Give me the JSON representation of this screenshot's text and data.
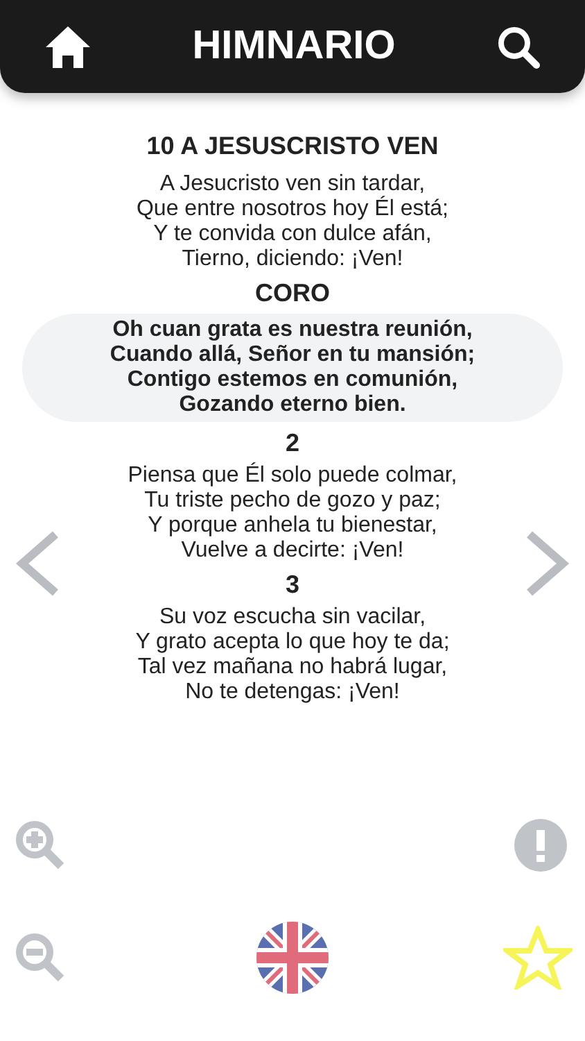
{
  "header": {
    "title": "HIMNARIO"
  },
  "hymn": {
    "title": "10 A JESUSCRISTO VEN",
    "sections": [
      {
        "kind": "verse",
        "lines": [
          "A Jesucristo ven sin tardar,",
          "Que entre nosotros hoy Él está;",
          "Y te convida con dulce afán,",
          "Tierno, diciendo: ¡Ven!"
        ]
      },
      {
        "kind": "chorus",
        "heading": "CORO",
        "lines": [
          "Oh cuan grata es nuestra reunión,",
          "Cuando allá, Señor en tu mansión;",
          "Contigo estemos en comunión,",
          "Gozando eterno bien."
        ]
      },
      {
        "kind": "verse",
        "heading": "2",
        "lines": [
          "Piensa que Él solo puede colmar,",
          "Tu triste pecho de gozo y paz;",
          "Y porque anhela tu bienestar,",
          "Vuelve a decirte: ¡Ven!"
        ]
      },
      {
        "kind": "verse",
        "heading": "3",
        "lines": [
          "Su voz escucha sin vacilar,",
          "Y grato acepta lo que hoy te da;",
          "Tal vez mañana no habrá lugar,",
          "No te detengas: ¡Ven!"
        ]
      }
    ]
  },
  "favorite": {
    "on": false
  }
}
